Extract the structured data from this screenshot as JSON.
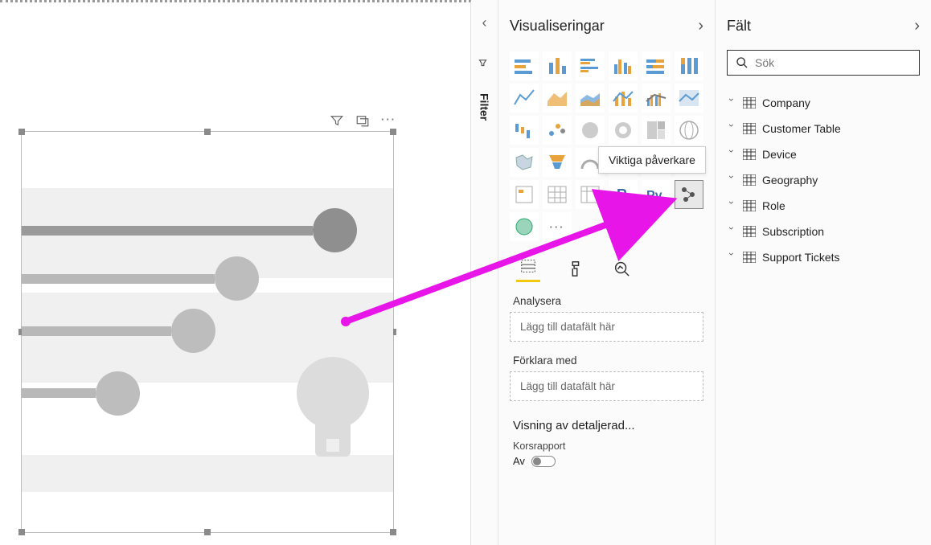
{
  "filters_panel": {
    "label": "Filter"
  },
  "visualizations": {
    "title": "Visualiseringar",
    "tooltip": "Viktiga påverkare",
    "wells": {
      "analyze_label": "Analysera",
      "analyze_placeholder": "Lägg till datafält här",
      "explain_label": "Förklara med",
      "explain_placeholder": "Lägg till datafält här"
    },
    "drill": {
      "section_title": "Visning av detaljerad...",
      "cross_label": "Korsrapport",
      "cross_state": "Av"
    }
  },
  "fields": {
    "title": "Fält",
    "search_placeholder": "Sök",
    "tables": [
      "Company",
      "Customer Table",
      "Device",
      "Geography",
      "Role",
      "Subscription",
      "Support Tickets"
    ]
  }
}
